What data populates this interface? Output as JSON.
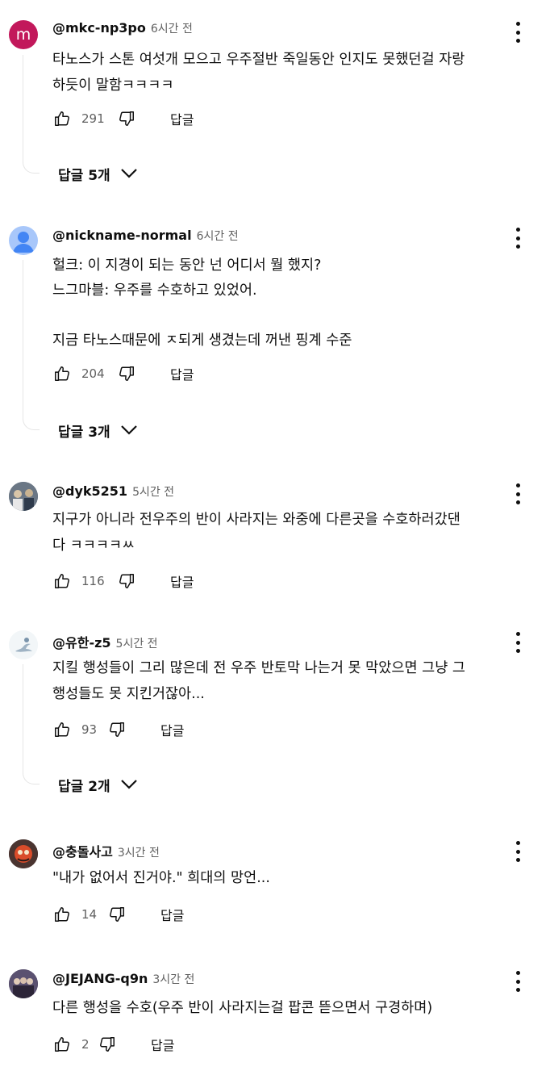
{
  "comments": [
    {
      "handle": "@mkc-np3po",
      "time": "6시간 전",
      "avatar_letter": "m",
      "text": "타노스가 스톤 여섯개 모으고 우주절반 죽일동안 인지도 못했던걸 자랑\n하듯이 말함ㅋㅋㅋㅋ",
      "likes": "291",
      "reply_label": "답글",
      "replies_label": "답글 5개"
    },
    {
      "handle": "@nickname-normal",
      "time": "6시간 전",
      "text": "헐크: 이 지경이 되는 동안 넌 어디서 뭘 했지?\n느그마블: 우주를 수호하고 있었어.\n\n지금 타노스때문에 ㅈ되게 생겼는데 꺼낸 핑계 수준",
      "likes": "204",
      "reply_label": "답글",
      "replies_label": "답글 3개"
    },
    {
      "handle": "@dyk5251",
      "time": "5시간 전",
      "text": "지구가 아니라 전우주의 반이 사라지는 와중에 다른곳을 수호하러갔댄\n다 ㅋㅋㅋㅋㅆ",
      "likes": "116",
      "reply_label": "답글"
    },
    {
      "handle": "@유한-z5",
      "time": "5시간 전",
      "text": "지킬 행성들이 그리 많은데 전 우주 반토막 나는거 못 막았으면 그냥 그\n행성들도 못 지킨거잖아...",
      "likes": "93",
      "reply_label": "답글",
      "replies_label": "답글 2개"
    },
    {
      "handle": "@충돌사고",
      "time": "3시간 전",
      "text": "\"내가 없어서 진거야.\" 희대의 망언...",
      "likes": "14",
      "reply_label": "답글"
    },
    {
      "handle": "@JEJANG-q9n",
      "time": "3시간 전",
      "text": "다른 행성을 수호(우주 반이 사라지는걸 팝콘 뜯으면서 구경하며)",
      "likes": "2",
      "reply_label": "답글"
    }
  ],
  "icons": {
    "like": "thumbs-up-icon",
    "dislike": "thumbs-down-icon",
    "more": "more-vert-icon",
    "expand": "chevron-down-icon"
  },
  "colors": {
    "avatar_m": "#c2185b",
    "text": "#0f0f0f",
    "secondary": "#606060"
  }
}
